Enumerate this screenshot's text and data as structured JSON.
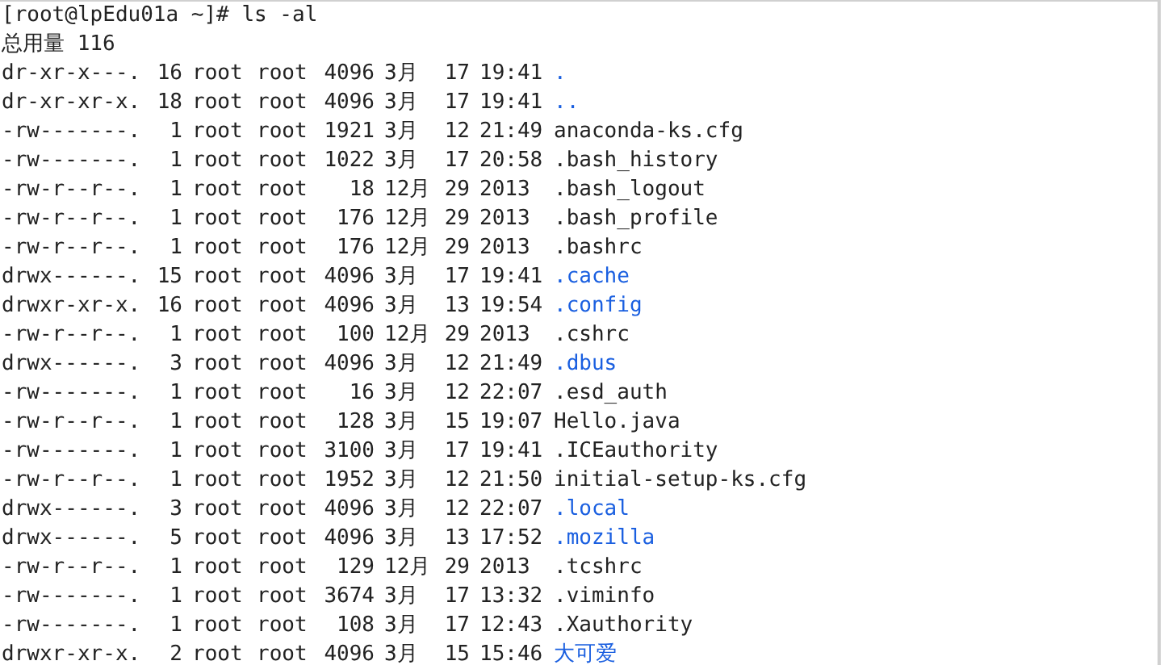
{
  "prompt": "[root@lpEdu01a ~]# ls -al",
  "total": "总用量 116",
  "entries": [
    {
      "perms": "dr-xr-x---.",
      "links": "16",
      "owner": "root",
      "group": "root",
      "size": "4096",
      "month": "3月",
      "day": "17",
      "time": "19:41",
      "name": ".",
      "kind": "dir"
    },
    {
      "perms": "dr-xr-xr-x.",
      "links": "18",
      "owner": "root",
      "group": "root",
      "size": "4096",
      "month": "3月",
      "day": "17",
      "time": "19:41",
      "name": "..",
      "kind": "dir"
    },
    {
      "perms": "-rw-------.",
      "links": "1",
      "owner": "root",
      "group": "root",
      "size": "1921",
      "month": "3月",
      "day": "12",
      "time": "21:49",
      "name": "anaconda-ks.cfg",
      "kind": "file"
    },
    {
      "perms": "-rw-------.",
      "links": "1",
      "owner": "root",
      "group": "root",
      "size": "1022",
      "month": "3月",
      "day": "17",
      "time": "20:58",
      "name": ".bash_history",
      "kind": "file"
    },
    {
      "perms": "-rw-r--r--.",
      "links": "1",
      "owner": "root",
      "group": "root",
      "size": "18",
      "month": "12月",
      "day": "29",
      "time": "2013",
      "name": ".bash_logout",
      "kind": "file"
    },
    {
      "perms": "-rw-r--r--.",
      "links": "1",
      "owner": "root",
      "group": "root",
      "size": "176",
      "month": "12月",
      "day": "29",
      "time": "2013",
      "name": ".bash_profile",
      "kind": "file"
    },
    {
      "perms": "-rw-r--r--.",
      "links": "1",
      "owner": "root",
      "group": "root",
      "size": "176",
      "month": "12月",
      "day": "29",
      "time": "2013",
      "name": ".bashrc",
      "kind": "file"
    },
    {
      "perms": "drwx------.",
      "links": "15",
      "owner": "root",
      "group": "root",
      "size": "4096",
      "month": "3月",
      "day": "17",
      "time": "19:41",
      "name": ".cache",
      "kind": "dir"
    },
    {
      "perms": "drwxr-xr-x.",
      "links": "16",
      "owner": "root",
      "group": "root",
      "size": "4096",
      "month": "3月",
      "day": "13",
      "time": "19:54",
      "name": ".config",
      "kind": "dir"
    },
    {
      "perms": "-rw-r--r--.",
      "links": "1",
      "owner": "root",
      "group": "root",
      "size": "100",
      "month": "12月",
      "day": "29",
      "time": "2013",
      "name": ".cshrc",
      "kind": "file"
    },
    {
      "perms": "drwx------.",
      "links": "3",
      "owner": "root",
      "group": "root",
      "size": "4096",
      "month": "3月",
      "day": "12",
      "time": "21:49",
      "name": ".dbus",
      "kind": "dir"
    },
    {
      "perms": "-rw-------.",
      "links": "1",
      "owner": "root",
      "group": "root",
      "size": "16",
      "month": "3月",
      "day": "12",
      "time": "22:07",
      "name": ".esd_auth",
      "kind": "file"
    },
    {
      "perms": "-rw-r--r--.",
      "links": "1",
      "owner": "root",
      "group": "root",
      "size": "128",
      "month": "3月",
      "day": "15",
      "time": "19:07",
      "name": "Hello.java",
      "kind": "file"
    },
    {
      "perms": "-rw-------.",
      "links": "1",
      "owner": "root",
      "group": "root",
      "size": "3100",
      "month": "3月",
      "day": "17",
      "time": "19:41",
      "name": ".ICEauthority",
      "kind": "file"
    },
    {
      "perms": "-rw-r--r--.",
      "links": "1",
      "owner": "root",
      "group": "root",
      "size": "1952",
      "month": "3月",
      "day": "12",
      "time": "21:50",
      "name": "initial-setup-ks.cfg",
      "kind": "file"
    },
    {
      "perms": "drwx------.",
      "links": "3",
      "owner": "root",
      "group": "root",
      "size": "4096",
      "month": "3月",
      "day": "12",
      "time": "22:07",
      "name": ".local",
      "kind": "dir"
    },
    {
      "perms": "drwx------.",
      "links": "5",
      "owner": "root",
      "group": "root",
      "size": "4096",
      "month": "3月",
      "day": "13",
      "time": "17:52",
      "name": ".mozilla",
      "kind": "dir"
    },
    {
      "perms": "-rw-r--r--.",
      "links": "1",
      "owner": "root",
      "group": "root",
      "size": "129",
      "month": "12月",
      "day": "29",
      "time": "2013",
      "name": ".tcshrc",
      "kind": "file"
    },
    {
      "perms": "-rw-------.",
      "links": "1",
      "owner": "root",
      "group": "root",
      "size": "3674",
      "month": "3月",
      "day": "17",
      "time": "13:32",
      "name": ".viminfo",
      "kind": "file"
    },
    {
      "perms": "-rw-------.",
      "links": "1",
      "owner": "root",
      "group": "root",
      "size": "108",
      "month": "3月",
      "day": "17",
      "time": "12:43",
      "name": ".Xauthority",
      "kind": "file"
    },
    {
      "perms": "drwxr-xr-x.",
      "links": "2",
      "owner": "root",
      "group": "root",
      "size": "4096",
      "month": "3月",
      "day": "15",
      "time": "15:46",
      "name": "大可爱",
      "kind": "dir"
    }
  ]
}
